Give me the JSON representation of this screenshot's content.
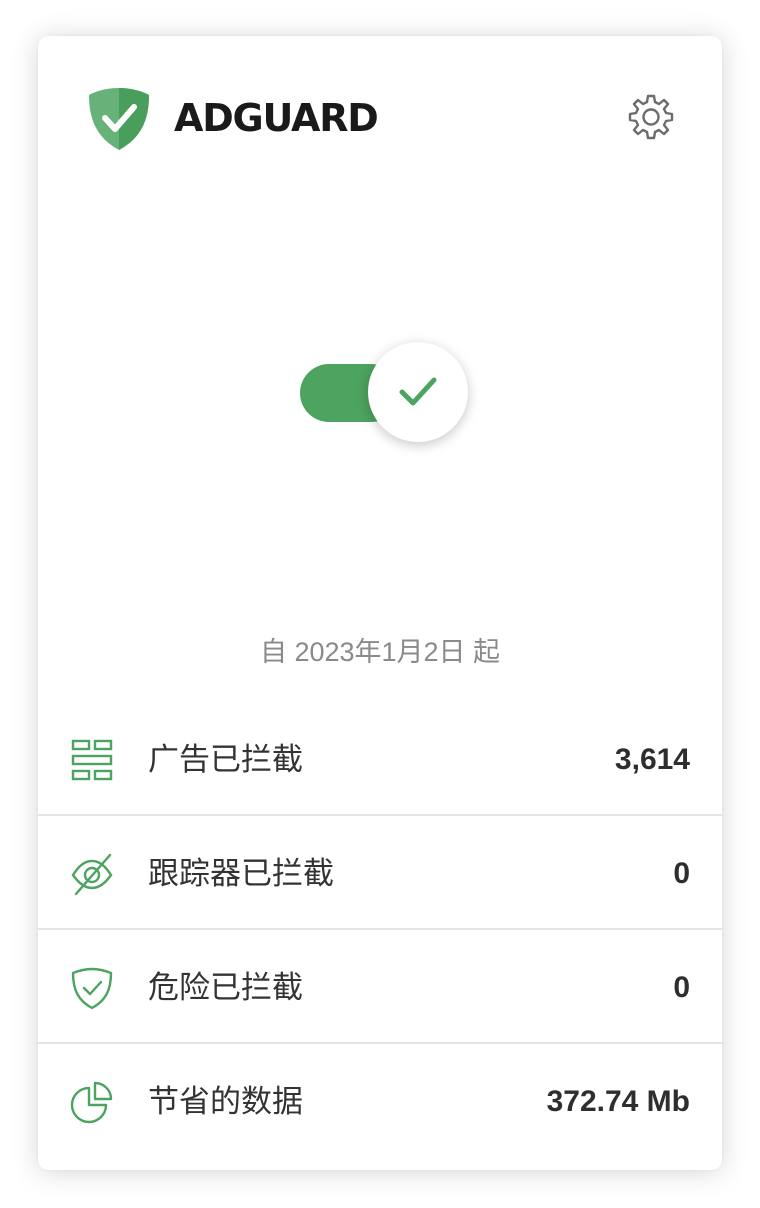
{
  "app": {
    "logo_text": "ADGUARD",
    "brand_color": "#4da360"
  },
  "protection": {
    "enabled": true,
    "since_text": "自 2023年1月2日 起"
  },
  "stats": [
    {
      "icon": "ads-blocked-icon",
      "label": "广告已拦截",
      "value": "3,614"
    },
    {
      "icon": "tracker-blocked-icon",
      "label": "跟踪器已拦截",
      "value": "0"
    },
    {
      "icon": "threat-shield-icon",
      "label": "危险已拦截",
      "value": "0"
    },
    {
      "icon": "data-pie-icon",
      "label": "节省的数据",
      "value": "372.74 Mb"
    }
  ]
}
